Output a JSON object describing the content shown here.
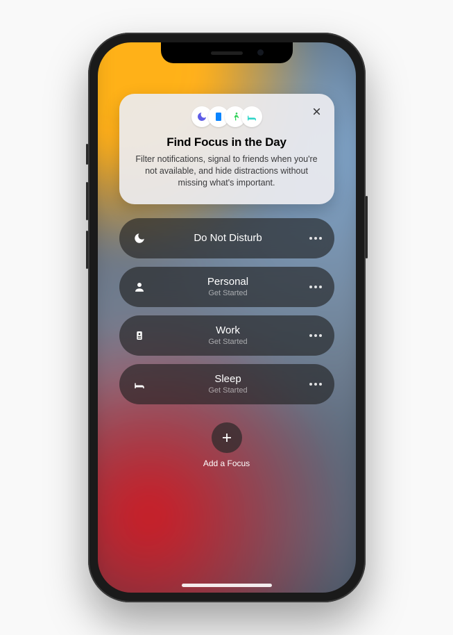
{
  "card": {
    "title": "Find Focus in the Day",
    "description": "Filter notifications, signal to friends when you're not available, and hide distractions without missing what's important.",
    "icons": [
      {
        "name": "moon-icon",
        "color": "#5e5ce6"
      },
      {
        "name": "book-icon",
        "color": "#0a84ff"
      },
      {
        "name": "running-icon",
        "color": "#30d158"
      },
      {
        "name": "bed-icon",
        "color": "#30d5c8"
      }
    ]
  },
  "focus_modes": [
    {
      "id": "dnd",
      "icon": "moon-icon",
      "title": "Do Not Disturb",
      "subtitle": ""
    },
    {
      "id": "personal",
      "icon": "person-icon",
      "title": "Personal",
      "subtitle": "Get Started"
    },
    {
      "id": "work",
      "icon": "badge-icon",
      "title": "Work",
      "subtitle": "Get Started"
    },
    {
      "id": "sleep",
      "icon": "bed-icon",
      "title": "Sleep",
      "subtitle": "Get Started"
    }
  ],
  "add": {
    "label": "Add a Focus"
  }
}
